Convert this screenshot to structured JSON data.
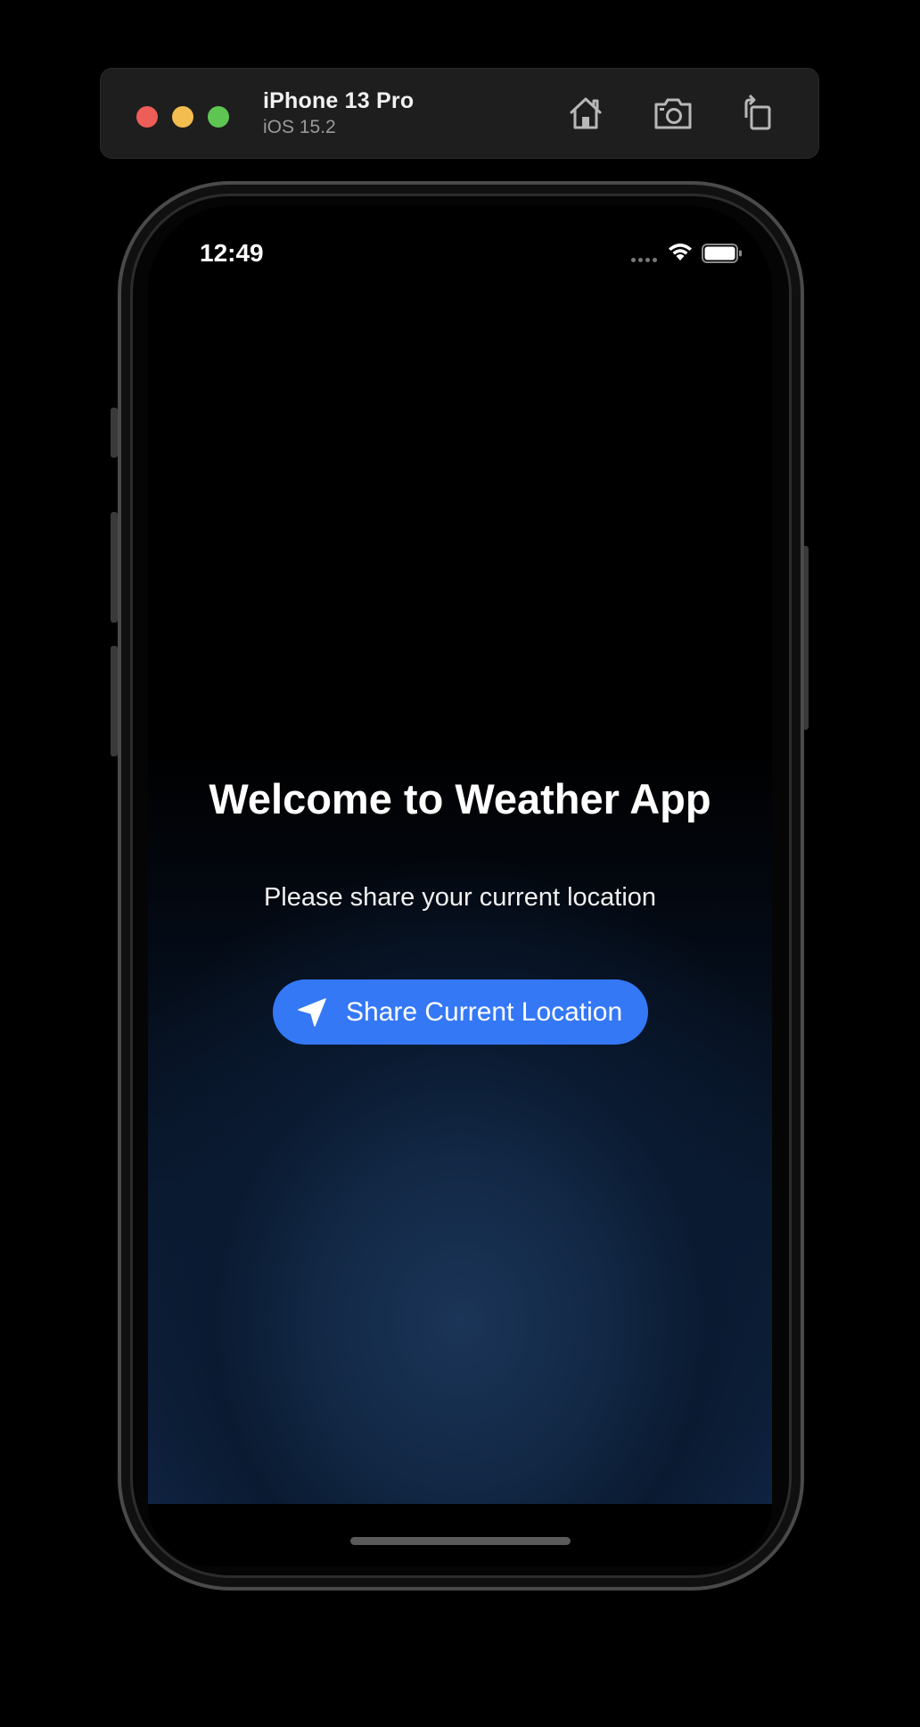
{
  "simulator": {
    "device_name": "iPhone 13 Pro",
    "os_version": "iOS 15.2",
    "window_controls": [
      "close",
      "minimize",
      "zoom"
    ],
    "toolbar_icons": [
      "home-icon",
      "screenshot-icon",
      "rotate-icon"
    ]
  },
  "status_bar": {
    "time": "12:49"
  },
  "main": {
    "title": "Welcome to Weather App",
    "subtitle": "Please share your current location",
    "share_button": {
      "label": "Share Current Location",
      "icon": "location-arrow-icon",
      "color": "#3478f6"
    }
  },
  "colors": {
    "background": "#000000",
    "gradient_bottom": "#1b3558",
    "accent": "#3478f6"
  }
}
